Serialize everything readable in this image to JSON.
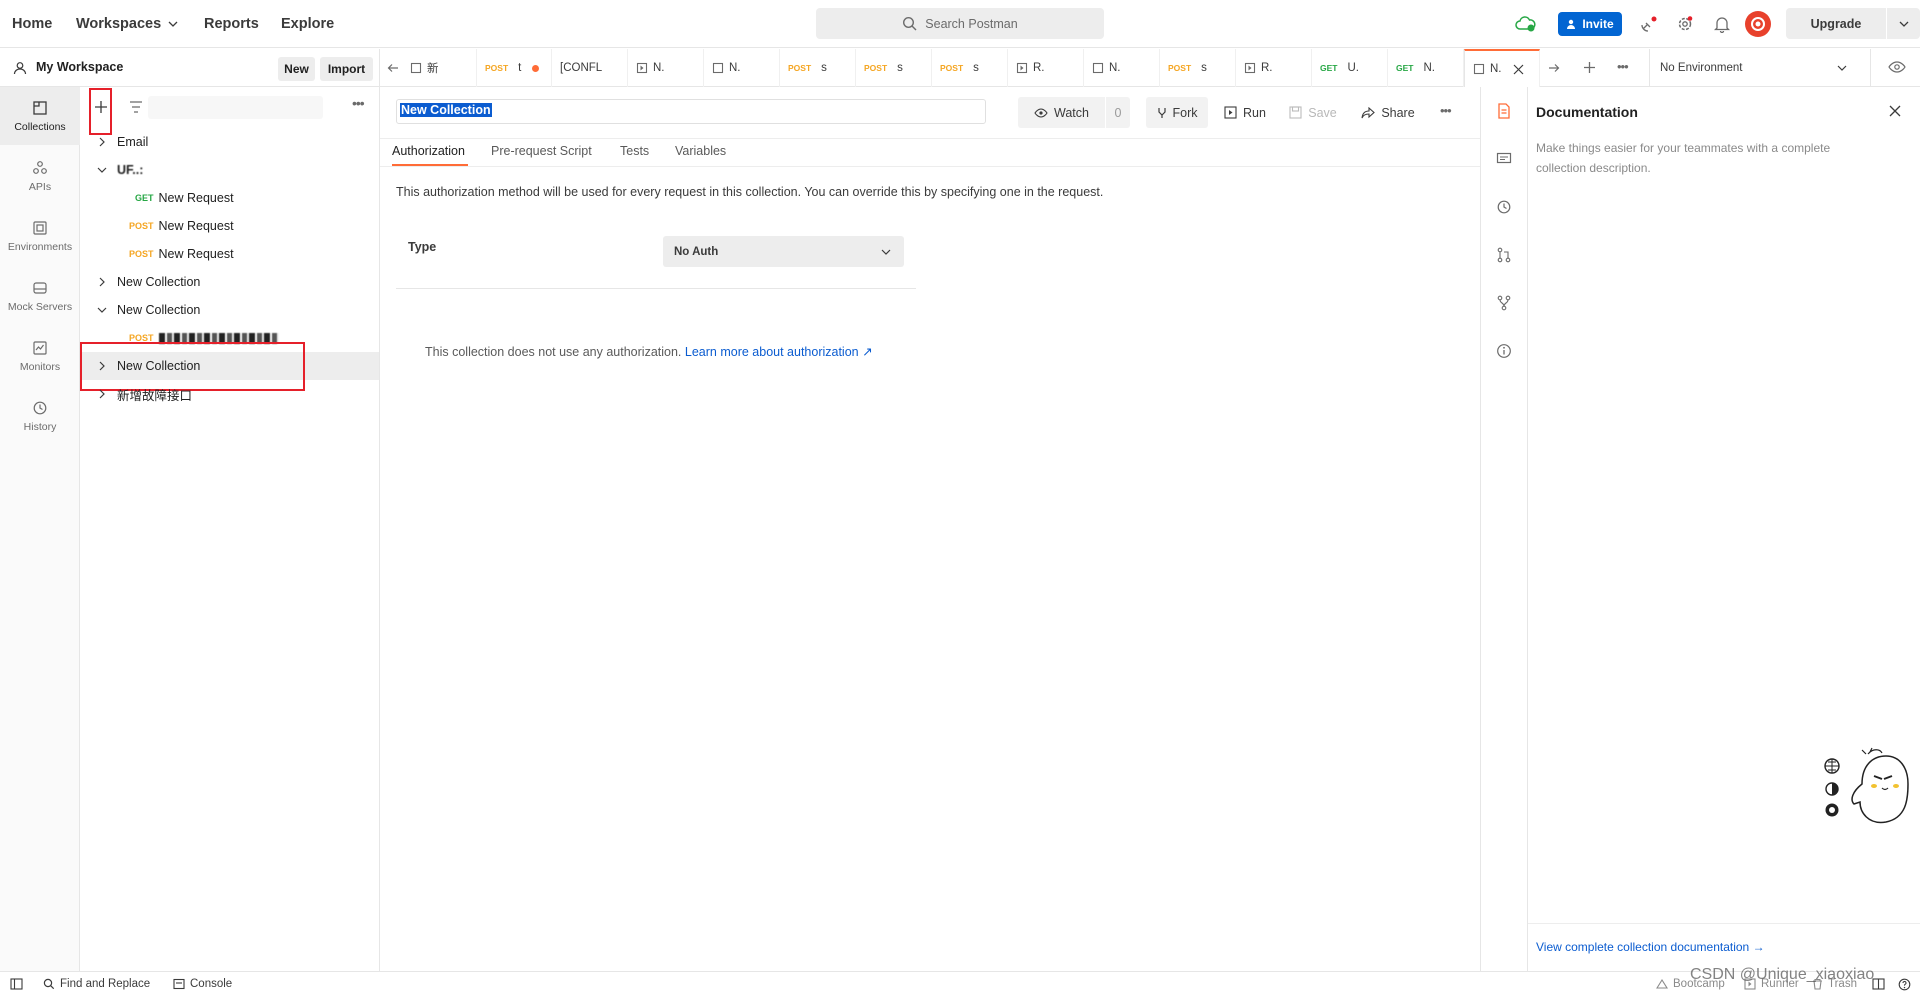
{
  "header": {
    "nav": [
      "Home",
      "Workspaces",
      "Reports",
      "Explore"
    ],
    "search_placeholder": "Search Postman",
    "invite_label": "Invite",
    "upgrade_label": "Upgrade"
  },
  "workspace": {
    "name": "My Workspace",
    "new_label": "New",
    "import_label": "Import"
  },
  "rail": [
    "Collections",
    "APIs",
    "Environments",
    "Mock Servers",
    "Monitors",
    "History"
  ],
  "tree": {
    "email": "Email",
    "blurred_collection": "UF..:",
    "req1": {
      "method": "GET",
      "name": "New Request"
    },
    "req2": {
      "method": "POST",
      "name": "New Request"
    },
    "req3": {
      "method": "POST",
      "name": "New Request"
    },
    "col1": "New Collection",
    "col2": "New Collection",
    "blurred_req": {
      "method": "POST",
      "name": "..."
    },
    "col3": "New Collection",
    "cn_item": "新增故障接口"
  },
  "tabs": [
    {
      "method": "",
      "label": "新"
    },
    {
      "method": "POST",
      "label": "t"
    },
    {
      "method": "",
      "label": "[CONFL"
    },
    {
      "method": "",
      "label": "N."
    },
    {
      "method": "",
      "label": "N."
    },
    {
      "method": "POST",
      "label": "s"
    },
    {
      "method": "POST",
      "label": "s"
    },
    {
      "method": "POST",
      "label": "s"
    },
    {
      "method": "",
      "label": "R."
    },
    {
      "method": "",
      "label": "N."
    },
    {
      "method": "POST",
      "label": "s"
    },
    {
      "method": "",
      "label": "R."
    },
    {
      "method": "GET",
      "label": "U."
    },
    {
      "method": "GET",
      "label": "N."
    },
    {
      "method": "",
      "label": "N."
    }
  ],
  "environment": "No Environment",
  "collection": {
    "name": "New Collection",
    "watch_label": "Watch",
    "watch_count": "0",
    "fork_label": "Fork",
    "run_label": "Run",
    "save_label": "Save",
    "share_label": "Share"
  },
  "subtabs": [
    "Authorization",
    "Pre-request Script",
    "Tests",
    "Variables"
  ],
  "auth": {
    "description": "This authorization method will be used for every request in this collection. You can override this by specifying one in the request.",
    "type_label": "Type",
    "type_value": "No Auth",
    "no_auth_msg": "This collection does not use any authorization.",
    "learn_more": "Learn more about authorization ↗"
  },
  "docs": {
    "title": "Documentation",
    "description": "Make things easier for your teammates with a complete collection description.",
    "link": "View complete collection documentation →"
  },
  "status": {
    "find_replace": "Find and Replace",
    "console": "Console",
    "bootcamp": "Bootcamp",
    "runner": "Runner",
    "trash": "Trash"
  },
  "watermark": "CSDN @Unique_xiaoxiao",
  "colors": {
    "get": "#27a745",
    "post": "#f5a623",
    "accent": "#ff6c37",
    "link": "#0b5cd0",
    "invite": "#0265d2",
    "annotation": "#e5202a"
  }
}
